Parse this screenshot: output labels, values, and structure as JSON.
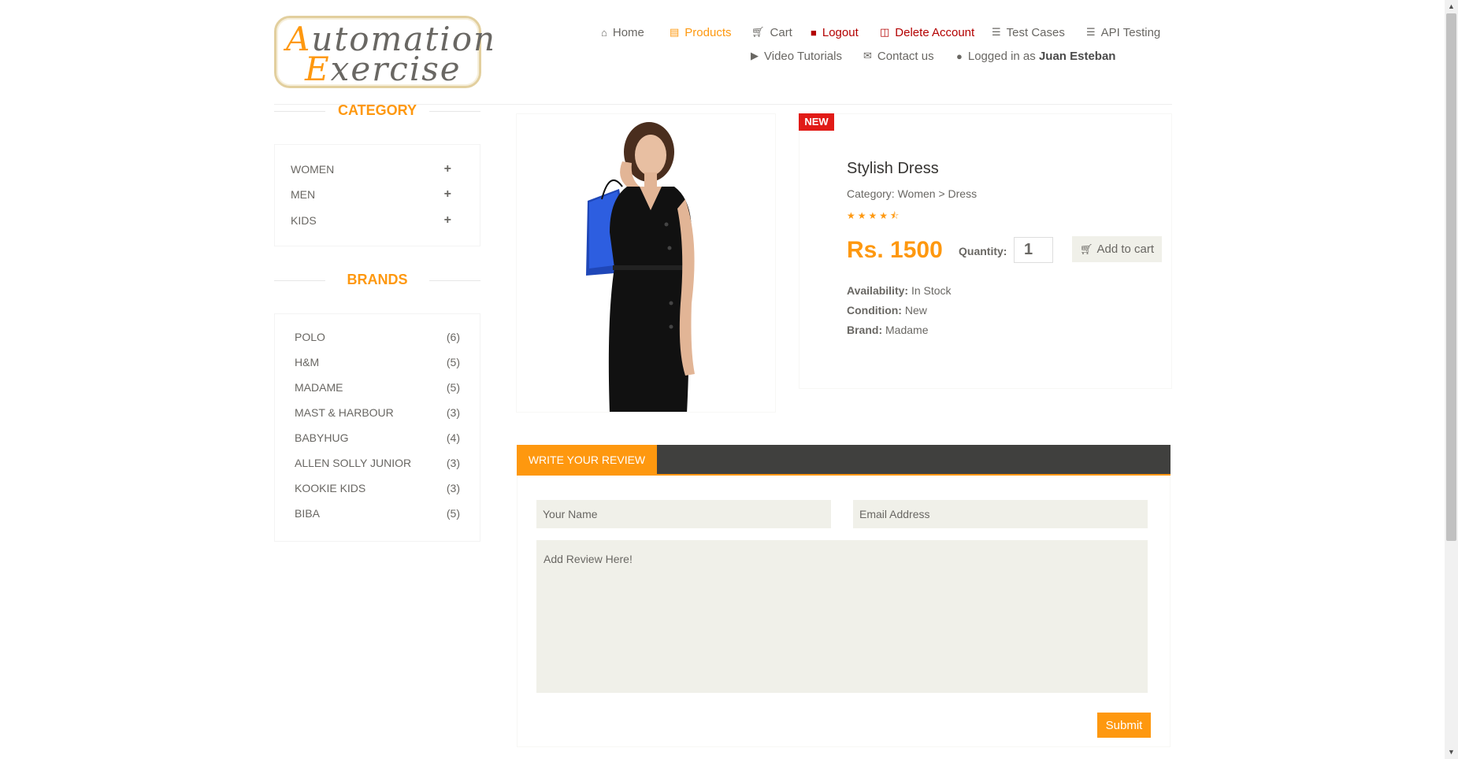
{
  "logo": {
    "line1_first": "A",
    "line1_rest": "utomation",
    "line2_first": "E",
    "line2_rest": "xercise"
  },
  "nav": {
    "home": {
      "icon": "home-icon",
      "label": "Home"
    },
    "products": {
      "icon": "products-icon",
      "label": "Products"
    },
    "cart": {
      "icon": "cart-icon",
      "label": "Cart"
    },
    "logout": {
      "icon": "lock-icon",
      "label": "Logout"
    },
    "delete": {
      "icon": "trash-icon",
      "label": "Delete Account"
    },
    "test_cases": {
      "icon": "list-icon",
      "label": "Test Cases"
    },
    "api_testing": {
      "icon": "list-icon",
      "label": "API Testing"
    },
    "video": {
      "icon": "youtube-play-icon",
      "label": "Video Tutorials"
    },
    "contact": {
      "icon": "envelope-icon",
      "label": "Contact us"
    },
    "logged_prefix": "Logged in as",
    "logged_user": "Juan Esteban"
  },
  "sidebar": {
    "category_title": "CATEGORY",
    "categories": [
      {
        "label": "WOMEN",
        "toggle": "+"
      },
      {
        "label": "MEN",
        "toggle": "+"
      },
      {
        "label": "KIDS",
        "toggle": "+"
      }
    ],
    "brands_title": "BRANDS",
    "brands": [
      {
        "label": "POLO",
        "count": "(6)"
      },
      {
        "label": "H&M",
        "count": "(5)"
      },
      {
        "label": "MADAME",
        "count": "(5)"
      },
      {
        "label": "MAST & HARBOUR",
        "count": "(3)"
      },
      {
        "label": "BABYHUG",
        "count": "(4)"
      },
      {
        "label": "ALLEN SOLLY JUNIOR",
        "count": "(3)"
      },
      {
        "label": "KOOKIE KIDS",
        "count": "(3)"
      },
      {
        "label": "BIBA",
        "count": "(5)"
      }
    ]
  },
  "product": {
    "badge": "NEW",
    "title": "Stylish Dress",
    "category": "Category: Women > Dress",
    "rating": 4.5,
    "rating_glyphs": "★★★★⯪",
    "price": "Rs. 1500",
    "quantity_label": "Quantity:",
    "quantity_value": "1",
    "add_to_cart": "Add to cart",
    "availability_label": "Availability:",
    "availability": "In Stock",
    "condition_label": "Condition:",
    "condition": "New",
    "brand_label": "Brand:",
    "brand": "Madame"
  },
  "review": {
    "tab": "WRITE YOUR REVIEW",
    "name_placeholder": "Your Name",
    "email_placeholder": "Email Address",
    "review_placeholder": "Add Review Here!",
    "submit": "Submit"
  },
  "colors": {
    "accent": "#fe980f",
    "danger": "#b30000",
    "badge": "#e11b17",
    "dark_bar": "#40403e"
  }
}
